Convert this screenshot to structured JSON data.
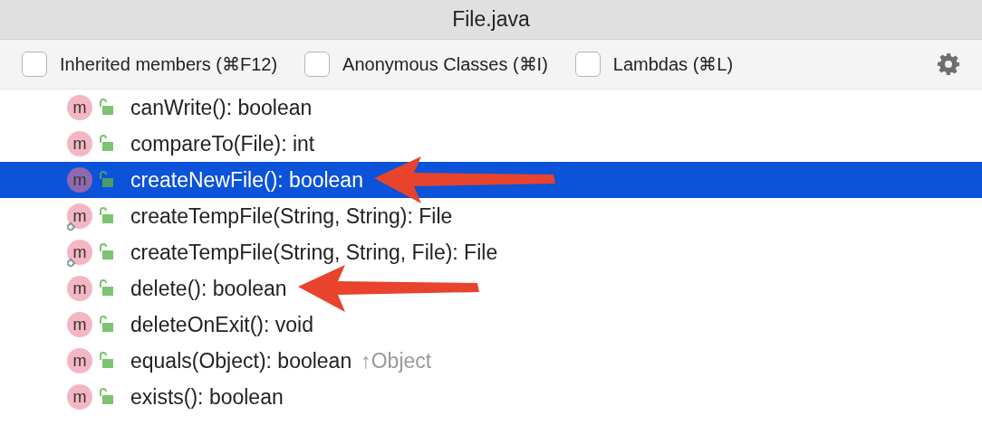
{
  "window": {
    "title": "File.java"
  },
  "filters": [
    {
      "label": "Inherited members (⌘F12)",
      "checked": false
    },
    {
      "label": "Anonymous Classes (⌘I)",
      "checked": false
    },
    {
      "label": "Lambdas (⌘L)",
      "checked": false
    }
  ],
  "members": [
    {
      "icon_letter": "m",
      "text": "canWrite(): boolean",
      "selected": false,
      "static": false,
      "arrow": false
    },
    {
      "icon_letter": "m",
      "text": "compareTo(File): int",
      "selected": false,
      "static": false,
      "arrow": false
    },
    {
      "icon_letter": "m",
      "text": "createNewFile(): boolean",
      "selected": true,
      "static": false,
      "arrow": true
    },
    {
      "icon_letter": "m",
      "text": "createTempFile(String, String): File",
      "selected": false,
      "static": true,
      "arrow": false
    },
    {
      "icon_letter": "m",
      "text": "createTempFile(String, String, File): File",
      "selected": false,
      "static": true,
      "arrow": false
    },
    {
      "icon_letter": "m",
      "text": "delete(): boolean",
      "selected": false,
      "static": false,
      "arrow": true
    },
    {
      "icon_letter": "m",
      "text": "deleteOnExit(): void",
      "selected": false,
      "static": false,
      "arrow": false
    },
    {
      "icon_letter": "m",
      "text": "equals(Object): boolean",
      "origin": "↑Object",
      "selected": false,
      "static": false,
      "arrow": false
    },
    {
      "icon_letter": "m",
      "text": "exists(): boolean",
      "selected": false,
      "static": false,
      "arrow": false
    }
  ]
}
